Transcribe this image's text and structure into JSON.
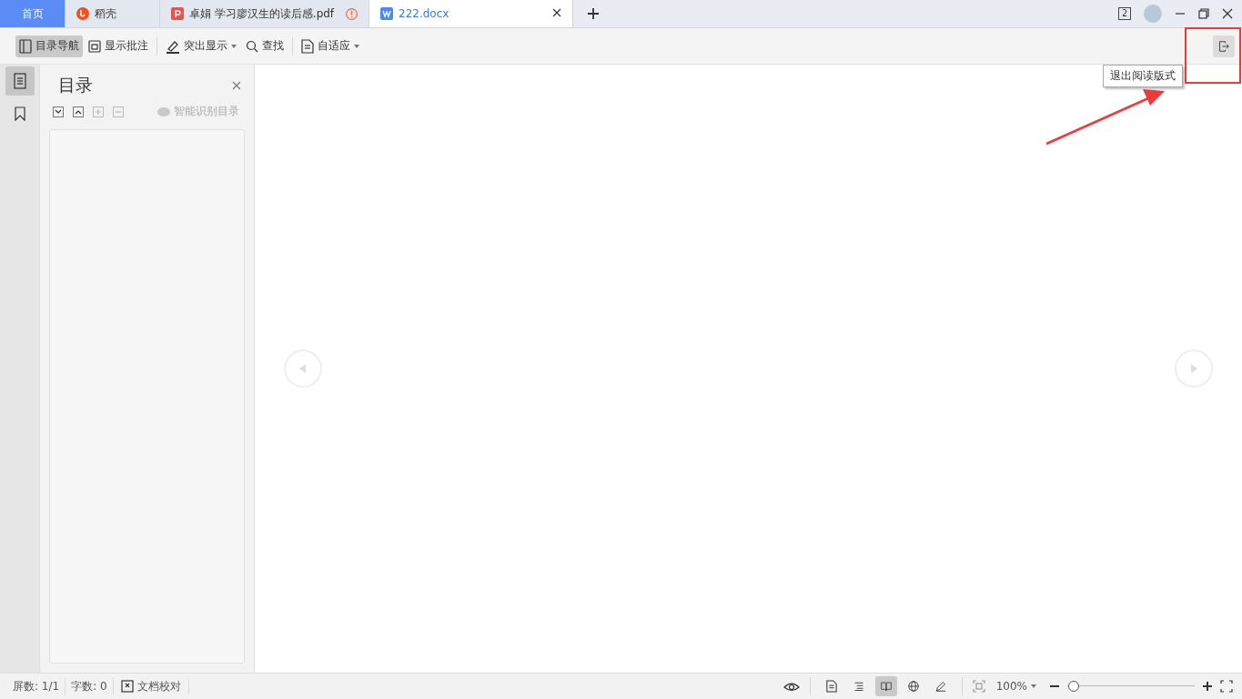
{
  "tabs": [
    {
      "label": "首页",
      "kind": "home",
      "selected": false
    },
    {
      "label": "稻壳",
      "kind": "docer",
      "selected": false
    },
    {
      "label": "卓娟 学习廖汉生的读后感.pdf",
      "kind": "pdf",
      "selected": false,
      "warning": true
    },
    {
      "label": "222.docx",
      "kind": "word",
      "selected": true,
      "warning": false
    }
  ],
  "window_badge": "2",
  "toolbar": {
    "groups": [
      [
        {
          "label": "目录导航",
          "selected": true,
          "dropdown": false
        },
        {
          "label": "显示批注",
          "selected": false,
          "dropdown": false
        }
      ],
      [
        {
          "label": "突出显示",
          "selected": false,
          "dropdown": true
        },
        {
          "label": "查找",
          "selected": false,
          "dropdown": false
        }
      ],
      [
        {
          "label": "自适应",
          "selected": false,
          "dropdown": true
        }
      ]
    ]
  },
  "tooltip": "退出阅读版式",
  "side_rail": [
    {
      "selected": true
    },
    {
      "selected": false
    }
  ],
  "panel": {
    "title": "目录",
    "smart_button": "智能识别目录"
  },
  "status_bar": {
    "screens": "屏数: 1/1",
    "words": "字数: 0",
    "proofread": "文档校对",
    "zoom": "100%",
    "level": 0.05,
    "view_modes": [
      {
        "selected": false
      },
      {
        "selected": false
      },
      {
        "selected": true
      },
      {
        "selected": false
      },
      {
        "selected": false
      }
    ]
  }
}
